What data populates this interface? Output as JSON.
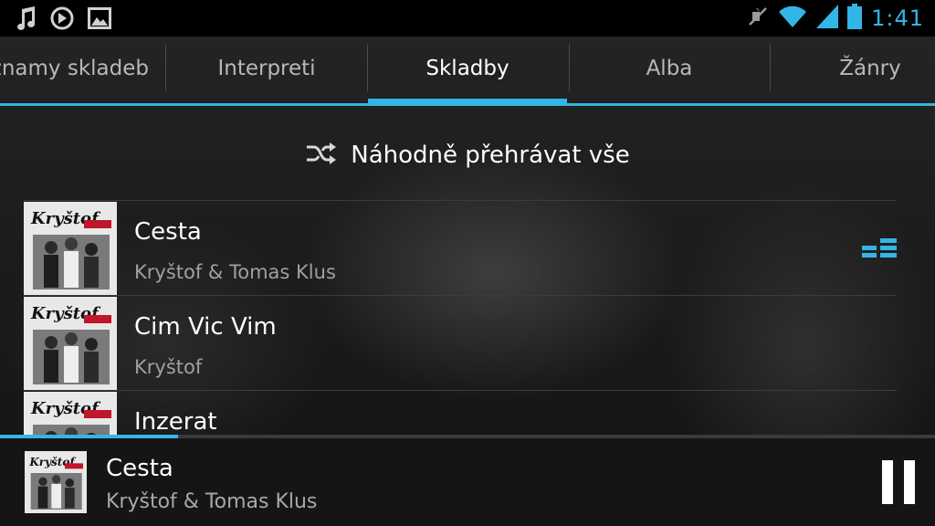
{
  "status_bar": {
    "time": "1:41",
    "icons_left": [
      "music-note-icon",
      "sync-icon",
      "image-icon"
    ],
    "icons_right": [
      "mute-icon",
      "wifi-icon",
      "signal-icon",
      "battery-icon"
    ]
  },
  "tabs": [
    {
      "label": "Seznamy skladeb",
      "active": false
    },
    {
      "label": "Interpreti",
      "active": false
    },
    {
      "label": "Skladby",
      "active": true
    },
    {
      "label": "Alba",
      "active": false
    },
    {
      "label": "Žánry",
      "active": false
    }
  ],
  "shuffle": {
    "label": "Náhodně přehrávat vše",
    "icon": "shuffle-icon"
  },
  "songs": [
    {
      "title": "Cesta",
      "artist": "Kryštof & Tomas Klus",
      "playing": true
    },
    {
      "title": "Cim Vic Vim",
      "artist": "Kryštof",
      "playing": false
    },
    {
      "title": "Inzerat",
      "artist": "",
      "playing": false
    }
  ],
  "now_playing": {
    "title": "Cesta",
    "artist": "Kryštof & Tomas Klus",
    "progress": 0.19
  },
  "colors": {
    "accent": "#33b5e5"
  }
}
